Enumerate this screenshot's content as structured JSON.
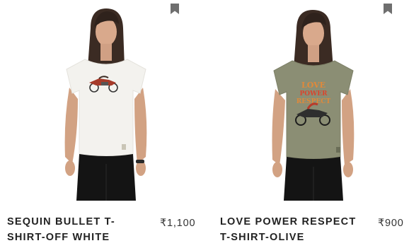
{
  "products": [
    {
      "name": "SEQUIN BULLET T-SHIRT-OFF WHITE",
      "price": "₹1,100",
      "colors": {
        "shirt": "#f3f2ee",
        "hair": "#3a2a22",
        "pants": "#141414"
      }
    },
    {
      "name": "LOVE POWER RESPECT T-SHIRT-OLIVE",
      "price": "₹900",
      "colors": {
        "shirt": "#8b8e74",
        "hair": "#3a2a22",
        "pants": "#141414"
      }
    }
  ],
  "icons": {
    "wishlist": "bookmark-icon"
  }
}
